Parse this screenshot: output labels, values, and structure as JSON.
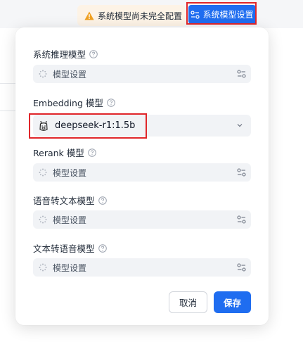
{
  "header": {
    "warning_text": "系统模型尚未完全配置",
    "system_model_button": "系统模型设置"
  },
  "fields": {
    "reasoning": {
      "label": "系统推理模型",
      "placeholder": "模型设置"
    },
    "embedding": {
      "label": "Embedding 模型",
      "value": "deepseek-r1:1.5b"
    },
    "rerank": {
      "label": "Rerank 模型",
      "placeholder": "模型设置"
    },
    "stt": {
      "label": "语音转文本模型",
      "placeholder": "模型设置"
    },
    "tts": {
      "label": "文本转语音模型",
      "placeholder": "模型设置"
    }
  },
  "footer": {
    "cancel_label": "取消",
    "save_label": "保存"
  },
  "colors": {
    "primary": "#1f6df0",
    "warning": "#f0a020",
    "highlight": "#e0262a"
  }
}
